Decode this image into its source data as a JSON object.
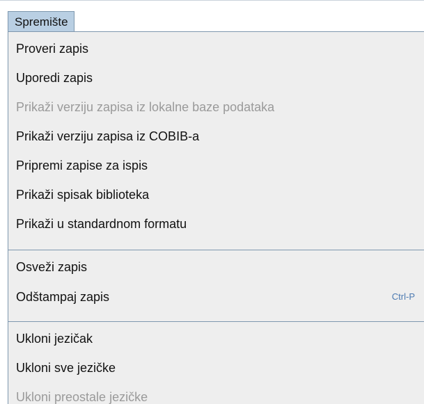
{
  "menu": {
    "title": "Spremište",
    "groups": [
      {
        "items": [
          {
            "label": "Proveri zapis",
            "enabled": true
          },
          {
            "label": "Uporedi zapis",
            "enabled": true
          },
          {
            "label": "Prikaži verziju zapisa iz lokalne baze podataka",
            "enabled": false
          },
          {
            "label": "Prikaži verziju zapisa iz COBIB-a",
            "enabled": true
          },
          {
            "label": "Pripremi zapise za ispis",
            "enabled": true
          },
          {
            "label": "Prikaži spisak biblioteka",
            "enabled": true
          },
          {
            "label": "Prikaži u standardnom formatu",
            "enabled": true
          }
        ]
      },
      {
        "items": [
          {
            "label": "Osveži zapis",
            "enabled": true
          },
          {
            "label": "Odštampaj zapis",
            "enabled": true,
            "shortcut": "Ctrl-P"
          }
        ]
      },
      {
        "items": [
          {
            "label": "Ukloni jezičak",
            "enabled": true
          },
          {
            "label": "Ukloni sve jezičke",
            "enabled": true
          },
          {
            "label": "Ukloni preostale jezičke",
            "enabled": false
          }
        ]
      }
    ]
  },
  "colors": {
    "menu_background": "#eeeeee",
    "title_highlight": "#b9cfe3",
    "border": "#7e97ae",
    "disabled_text": "#9a9a9a",
    "shortcut_text": "#4c7ab1"
  }
}
